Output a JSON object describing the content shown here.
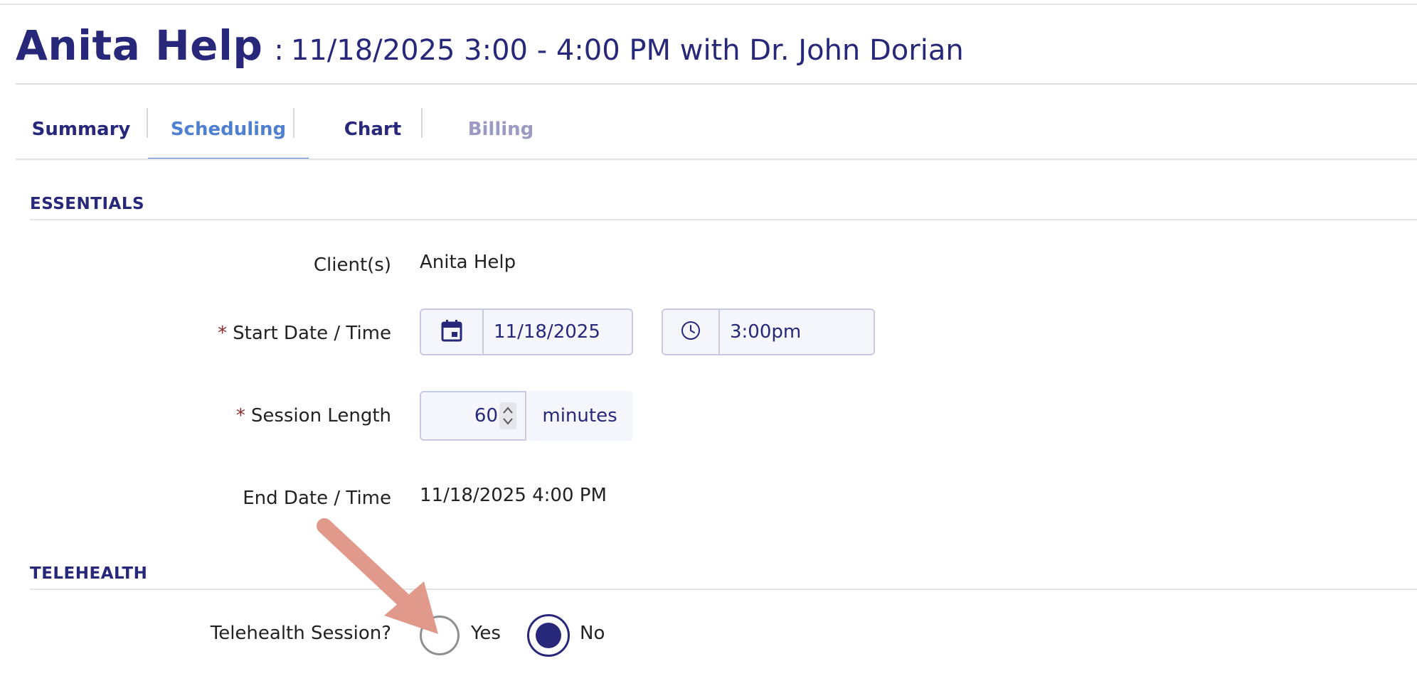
{
  "header": {
    "patient_name": "Anita Help",
    "separator": ":",
    "appointment": "11/18/2025 3:00 - 4:00 PM with Dr. John Dorian"
  },
  "tabs": [
    {
      "label": "Summary",
      "state": "normal"
    },
    {
      "label": "Scheduling",
      "state": "active"
    },
    {
      "label": "Chart",
      "state": "normal"
    },
    {
      "label": "Billing",
      "state": "muted"
    }
  ],
  "essentials": {
    "title": "ESSENTIALS",
    "clients_label": "Client(s)",
    "clients_value": "Anita Help",
    "start_label": "Start Date / Time",
    "start_date": "11/18/2025",
    "start_time": "3:00pm",
    "length_label": "Session Length",
    "length_value": "60",
    "length_units": "minutes",
    "end_label": "End Date / Time",
    "end_value": "11/18/2025 4:00 PM",
    "required_mark": "*"
  },
  "telehealth": {
    "title": "TELEHEALTH",
    "question_label": "Telehealth Session?",
    "options": [
      {
        "label": "Yes",
        "selected": false
      },
      {
        "label": "No",
        "selected": true
      }
    ]
  },
  "icons": {
    "date": "calendar-icon",
    "time": "clock-icon",
    "spinner": "chevron-up-down-icon",
    "annotation": "arrow-annotation"
  },
  "colors": {
    "brand_navy": "#27287a",
    "active_tab": "#4f7fd1",
    "muted_tab": "#9a9ac2",
    "required": "#8a2a2a",
    "annotation_arrow": "#e0998a"
  }
}
